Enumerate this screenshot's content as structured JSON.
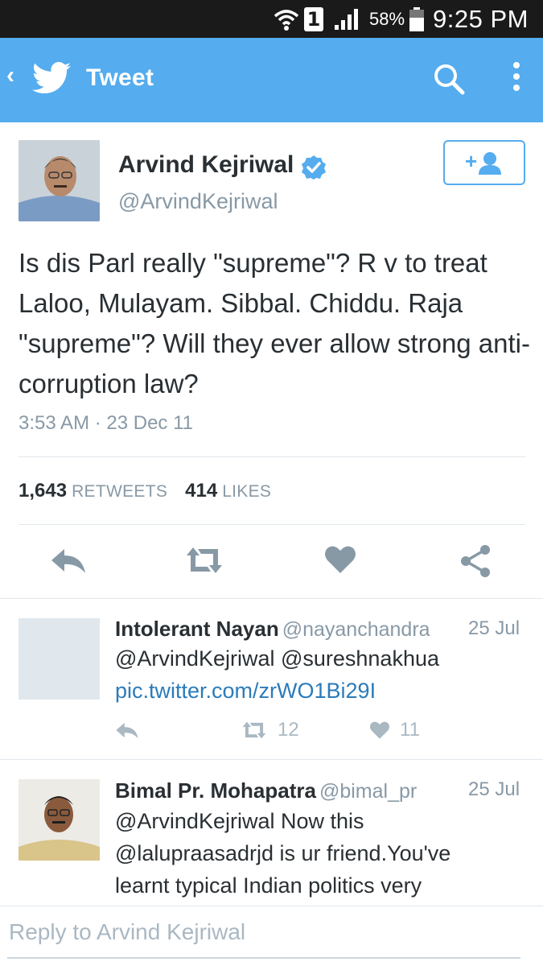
{
  "status_bar": {
    "sim_slot": "1",
    "battery_percent": "58%",
    "time": "9:25 PM"
  },
  "app_bar": {
    "back_icon": "chevron-left",
    "logo_icon": "twitter-bird",
    "title": "Tweet",
    "search_icon": "search",
    "menu_icon": "more-vertical"
  },
  "tweet": {
    "author_name": "Arvind Kejriwal",
    "author_handle": "@ArvindKejriwal",
    "verified": true,
    "follow_icon": "add-user",
    "text": "Is dis Parl really \"supreme\"? R v to treat Laloo, Mulayam. Sibbal. Chiddu. Raja \"supreme\"? Will they ever allow strong anti-corruption law?",
    "timestamp": "3:53 AM · 23 Dec 11",
    "retweets_count": "1,643",
    "retweets_label": "RETWEETS",
    "likes_count": "414",
    "likes_label": "LIKES"
  },
  "replies": [
    {
      "name": "Intolerant Nayan",
      "handle": "@nayanchandra",
      "date": "25 Jul",
      "text": "@ArvindKejriwal @sureshnakhua",
      "link": "pic.twitter.com/zrWO1Bi29I",
      "retweets": "12",
      "likes": "11"
    },
    {
      "name": "Bimal Pr. Mohapatra",
      "handle": "@bimal_pr",
      "date": "25 Jul",
      "text_lines": [
        "@ArvindKejriwal Now this",
        "@lalupraasadrjd is ur friend.You've",
        "learnt typical Indian politics very"
      ]
    }
  ],
  "compose": {
    "placeholder": "Reply to Arvind Kejriwal"
  },
  "colors": {
    "brand": "#55acee",
    "link": "#2b7bb9",
    "muted": "#8899a6",
    "icon": "#aab8c2"
  }
}
